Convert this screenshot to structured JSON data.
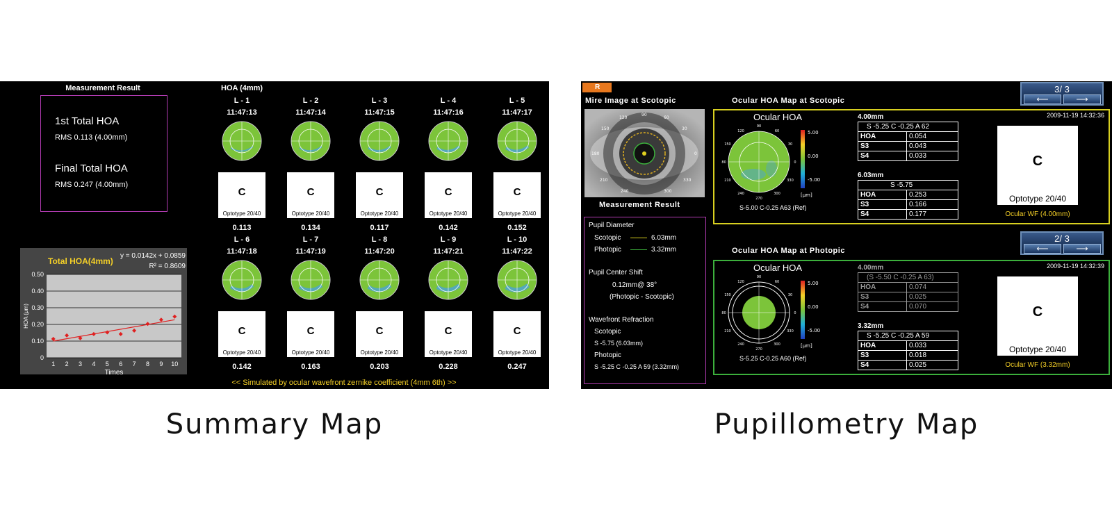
{
  "summary": {
    "mr_title": "Measurement Result",
    "first_head": "1st Total HOA",
    "first_rms": "RMS  0.113 (4.00mm)",
    "final_head": "Final Total HOA",
    "final_rms": "RMS  0.247 (4.00mm)",
    "hoa_title": "HOA (4mm)",
    "optotype_label": "Optotype 20/40",
    "optotype_glyph": "C",
    "cells": [
      {
        "label": "L - 1",
        "time": "11:47:13",
        "value": "0.113"
      },
      {
        "label": "L - 2",
        "time": "11:47:14",
        "value": "0.134"
      },
      {
        "label": "L - 3",
        "time": "11:47:15",
        "value": "0.117"
      },
      {
        "label": "L - 4",
        "time": "11:47:16",
        "value": "0.142"
      },
      {
        "label": "L - 5",
        "time": "11:47:17",
        "value": "0.152"
      },
      {
        "label": "L - 6",
        "time": "11:47:18",
        "value": "0.142"
      },
      {
        "label": "L - 7",
        "time": "11:47:19",
        "value": "0.163"
      },
      {
        "label": "L - 8",
        "time": "11:47:20",
        "value": "0.203"
      },
      {
        "label": "L - 9",
        "time": "11:47:21",
        "value": "0.228"
      },
      {
        "label": "L - 10",
        "time": "11:47:22",
        "value": "0.247"
      }
    ],
    "sim_note": "<< Simulated by ocular wavefront zernike coefficient (4mm 6th) >>",
    "caption": "Summary Map"
  },
  "chart_data": {
    "type": "scatter",
    "title": "Total HOA(4mm)",
    "xlabel": "Times",
    "ylabel": "HOA (μm)",
    "x": [
      1,
      2,
      3,
      4,
      5,
      6,
      7,
      8,
      9,
      10
    ],
    "y": [
      0.113,
      0.134,
      0.117,
      0.142,
      0.152,
      0.142,
      0.163,
      0.203,
      0.228,
      0.247
    ],
    "xticks": [
      "1",
      "2",
      "3",
      "4",
      "5",
      "6",
      "7",
      "8",
      "9",
      "10"
    ],
    "yticks": [
      "0",
      "0.10",
      "0.20",
      "0.30",
      "0.40",
      "0.50"
    ],
    "ylim": [
      0,
      0.5
    ],
    "xlim": [
      0.5,
      10.5
    ],
    "trendline": {
      "slope": 0.0142,
      "intercept": 0.0859
    },
    "equation": "y = 0.0142x + 0.0859",
    "r2_label": "R² = 0.8609",
    "grid": true,
    "colors": {
      "points": "#e02020",
      "line": "#e02020",
      "background": "#c8c8c8",
      "title": "#f5d027"
    }
  },
  "pupil": {
    "badge": "R",
    "mire_title": "Mire Image at Scotopic",
    "mr_title": "Measurement Result",
    "pupil_diameter": "Pupil Diameter",
    "scotopic_label": "Scotopic",
    "scotopic_value": "6.03mm",
    "photopic_label": "Photopic",
    "photopic_value": "3.32mm",
    "center_shift": "Pupil Center Shift",
    "shift_value": "0.12mm@ 38°",
    "shift_note": "(Photopic - Scotopic)",
    "wf_refraction": "Wavefront Refraction",
    "wf_scotopic_label": "Scotopic",
    "wf_scotopic_value": "S -5.75    (6.03mm)",
    "wf_photopic_label": "Photopic",
    "wf_photopic_value": "S -5.25 C -0.25 A  59     (3.32mm)",
    "scale_ticks": [
      "5.00",
      "0.00",
      "-5.00"
    ],
    "scale_unit": "[μm]",
    "caption": "Pupillometry Map",
    "scotopic": {
      "section_title": "Ocular HOA Map at Scotopic",
      "map_title": "Ocular HOA",
      "date": "2009-11-19 14:32:36",
      "ref": "S-5.00 C-0.25 A63 (Ref)",
      "pager": "3/ 3",
      "t1_label": "4.00mm",
      "t1_header": "S -5.25  C -0.25  A  62",
      "t1_rows": [
        [
          "HOA",
          "0.054"
        ],
        [
          "S3",
          "0.043"
        ],
        [
          "S4",
          "0.033"
        ]
      ],
      "t2_label": "6.03mm",
      "t2_header": "S -5.75",
      "t2_rows": [
        [
          "HOA",
          "0.253"
        ],
        [
          "S3",
          "0.166"
        ],
        [
          "S4",
          "0.177"
        ]
      ],
      "optotype": "Optotype 20/40",
      "wf_caption": "Ocular WF (4.00mm)"
    },
    "photopic": {
      "section_title": "Ocular HOA Map at Photopic",
      "map_title": "Ocular HOA",
      "date": "2009-11-19 14:32:39",
      "ref": "S-5.25 C-0.25 A60 (Ref)",
      "pager": "2/ 3",
      "t1_label": "4.00mm",
      "t1_header": "(S -5.50  C -0.25  A  63)",
      "t1_rows": [
        [
          "HOA",
          "0.074"
        ],
        [
          "S3",
          "0.025"
        ],
        [
          "S4",
          "0.070"
        ]
      ],
      "t2_label": "3.32mm",
      "t2_header": "S -5.25  C -0.25  A  59",
      "t2_rows": [
        [
          "HOA",
          "0.033"
        ],
        [
          "S3",
          "0.018"
        ],
        [
          "S4",
          "0.025"
        ]
      ],
      "optotype": "Optotype 20/40",
      "wf_caption": "Ocular WF (3.32mm)"
    },
    "optotype_glyph": "C",
    "arrow_left": "⟵",
    "arrow_right": "⟶",
    "colors": {
      "scotopic_frame": "#d8d020",
      "photopic_frame": "#3cb03c",
      "mr_border": "#b43cb4",
      "badge": "#e8781e"
    }
  }
}
